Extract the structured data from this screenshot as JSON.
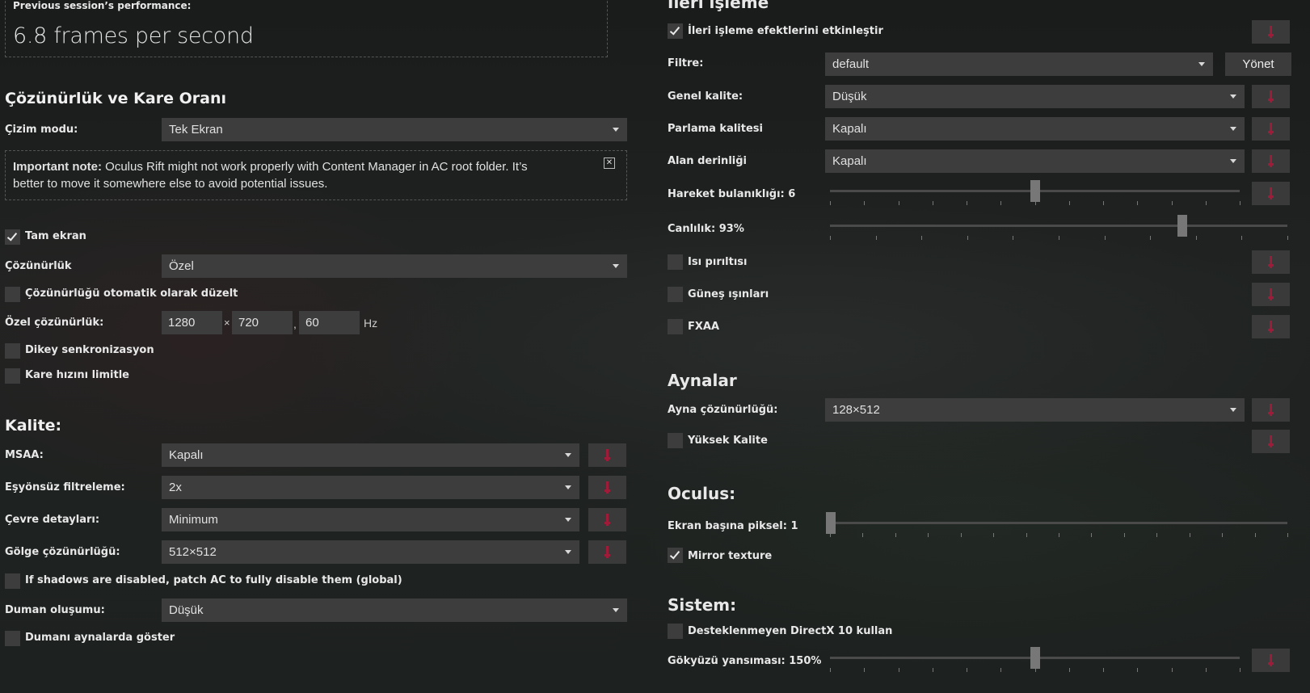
{
  "performance": {
    "label": "Previous session’s performance:",
    "value": "6.8 frames per second"
  },
  "resolution_section": {
    "title": "Çözünürlük ve Kare Oranı",
    "render_mode_label": "Çizim modu:",
    "render_mode_value": "Tek Ekran",
    "note_bold": "Important note:",
    "note_text_line1": " Oculus Rift might not work properly with Content Manager in AC root folder. It’s",
    "note_text_line2": "better to move it somewhere else to avoid potential issues.",
    "note_close": "✕",
    "fullscreen_label": "Tam ekran",
    "resolution_label": "Çözünürlük",
    "resolution_value": "Özel",
    "auto_fix_label": "Çözünürlüğü otomatik olarak düzelt",
    "custom_res_label": "Özel çözünürlük:",
    "width": "1280",
    "times": "×",
    "height": "720",
    "comma": ",",
    "refresh": "60",
    "hz": "Hz",
    "vsync_label": "Dikey senkronizasyon",
    "fps_limit_label": "Kare hızını limitle"
  },
  "quality_section": {
    "title": "Kalite:",
    "msaa_label": "MSAA:",
    "msaa_value": "Kapalı",
    "aniso_label": "Eşyönsüz filtreleme:",
    "aniso_value": "2x",
    "world_label": "Çevre detayları:",
    "world_value": "Minimum",
    "shadow_label": "Gölge çözünürlüğü:",
    "shadow_value": "512×512",
    "shadow_patch_label": "If shadows are disabled, patch AC to fully disable them (global)",
    "smoke_label": "Duman oluşumu:",
    "smoke_value": "Düşük",
    "smoke_mirrors_label": "Dumanı aynalarda göster"
  },
  "postproc_section": {
    "title": "İleri işleme",
    "enable_label": "İleri işleme efektlerini etkinleştir",
    "filter_label": "Filtre:",
    "filter_value": "default",
    "manage_button": "Yönet",
    "overall_label": "Genel kalite:",
    "overall_value": "Düşük",
    "glare_label": "Parlama kalitesi",
    "glare_value": "Kapalı",
    "dof_label": "Alan derinliği",
    "dof_value": "Kapalı",
    "motion_blur_label": "Hareket bulanıklığı: 6",
    "motion_blur_level": 6,
    "motion_blur_max": 12,
    "saturation_label": "Canlılık: 93%",
    "saturation_level": 93,
    "heat_label": "Isı pırıltısı",
    "sunrays_label": "Güneş ışınları",
    "fxaa_label": "FXAA"
  },
  "mirrors_section": {
    "title": "Aynalar",
    "mirror_res_label": "Ayna çözünürlüğü:",
    "mirror_res_value": "128×512",
    "hq_label": "Yüksek Kalite"
  },
  "oculus_section": {
    "title": "Oculus:",
    "pixels_label": "Ekran başına piksel: 1",
    "pixels_level": 1,
    "mirror_texture_label": "Mirror texture"
  },
  "system_section": {
    "title": "Sistem:",
    "dx10_label": "Desteklenmeyen DirectX 10 kullan",
    "sky_label": "Gökyüzü yansıması: 150%",
    "sky_level": 150
  },
  "colors": {
    "reset_icon": "#9c1c3a",
    "control_bg": "#3d3d3d"
  }
}
